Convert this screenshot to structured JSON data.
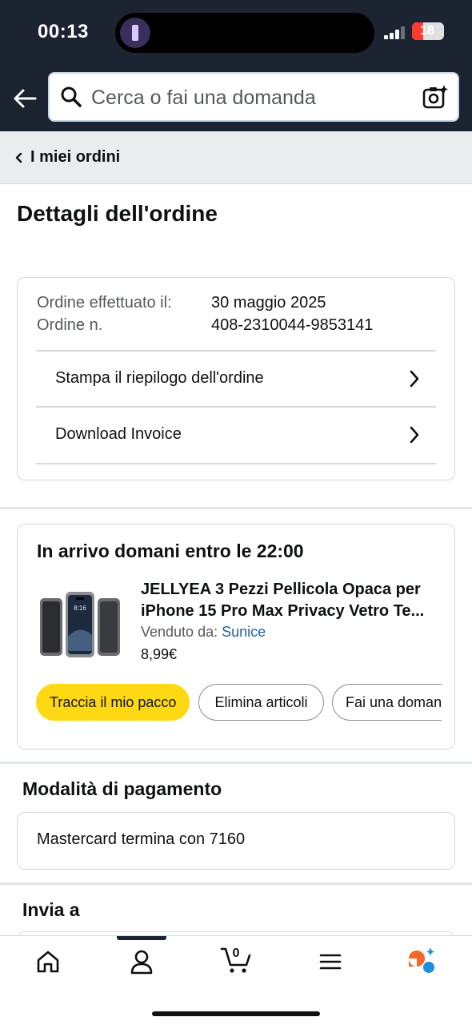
{
  "status_bar": {
    "time": "00:13",
    "battery": "18"
  },
  "header": {
    "search_placeholder": "Cerca o fai una domanda"
  },
  "breadcrumb": {
    "label": "I miei ordini"
  },
  "page": {
    "title": "Dettagli dell'ordine"
  },
  "order_info": {
    "date_label": "Ordine effettuato il:",
    "date_value": "30 maggio 2025",
    "number_label": "Ordine n.",
    "number_value": "408-2310044-9853141",
    "links": [
      {
        "label": "Stampa il riepilogo dell'ordine"
      },
      {
        "label": "Download Invoice"
      }
    ]
  },
  "shipment": {
    "title": "In arrivo domani entro le 22:00",
    "product": {
      "title_line1": "JELLYEA 3 Pezzi Pellicola Opaca per",
      "title_line2": "iPhone 15 Pro Max Privacy Vetro Te...",
      "sold_by_label": "Venduto da:",
      "seller": "Sunice",
      "price": "8,99€",
      "thumb_time": "8:16"
    },
    "buttons": {
      "track": "Traccia il mio pacco",
      "delete": "Elimina articoli",
      "ask": "Fai una domanda"
    }
  },
  "payment": {
    "title": "Modalità di pagamento",
    "method": "Mastercard termina con 7160"
  },
  "ship_to": {
    "title": "Invia a"
  },
  "tabbar": {
    "cart_count": "0",
    "tabs": [
      "home-icon",
      "account-icon",
      "cart-icon",
      "menu-icon",
      "rufus-icon"
    ]
  },
  "colors": {
    "header_bg": "#1b2430",
    "primary_button": "#ffd814",
    "link": "#2162a1",
    "battery_low": "#ff3b30"
  }
}
